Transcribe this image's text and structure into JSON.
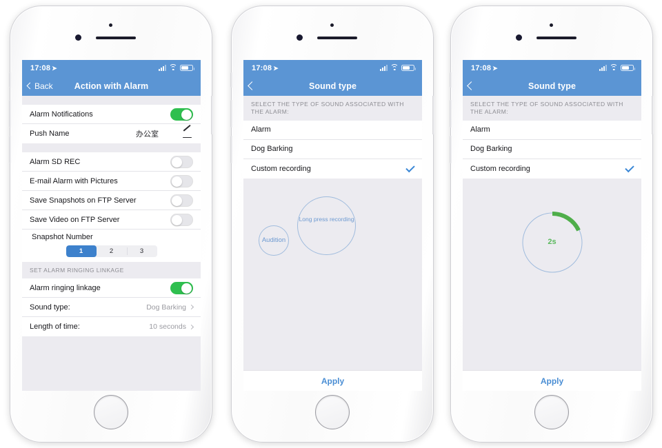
{
  "theme": {
    "header_blue": "#5b95d4",
    "accent_blue": "#3a87d6",
    "toggle_green": "#2fbf4f",
    "progress_green": "#4fae4a",
    "screen_gray": "#ecebf0"
  },
  "statusbar": {
    "time": "17:08",
    "location_arrow": "➤",
    "signal_icon": "cellular-bars-icon",
    "wifi_icon": "wifi-icon",
    "battery_icon": "battery-icon"
  },
  "phone1": {
    "nav": {
      "back_label": "Back",
      "title": "Action with Alarm"
    },
    "group1": [
      {
        "label": "Alarm Notifications",
        "control": "toggle",
        "on": true
      },
      {
        "label": "Push Name",
        "value": "办公室",
        "control": "pencil"
      }
    ],
    "group2": [
      {
        "label": "Alarm SD REC",
        "control": "toggle",
        "on": false
      },
      {
        "label": "E-mail Alarm with Pictures",
        "control": "toggle",
        "on": false
      },
      {
        "label": "Save Snapshots on FTP Server",
        "control": "toggle",
        "on": false
      },
      {
        "label": "Save Video on FTP Server",
        "control": "toggle",
        "on": false
      }
    ],
    "snapshot": {
      "label": "Snapshot Number",
      "options": [
        "1",
        "2",
        "3"
      ],
      "selected": "1"
    },
    "section_header": "SET ALARM RINGING LINKAGE",
    "group3": [
      {
        "label": "Alarm ringing linkage",
        "control": "toggle",
        "on": true
      },
      {
        "label": "Sound type:",
        "value": "Dog Barking",
        "control": "chevron"
      },
      {
        "label": "Length of time:",
        "value": "10 seconds",
        "control": "chevron"
      }
    ]
  },
  "phone2": {
    "nav": {
      "title": "Sound type",
      "back_icon": "chevron-left-icon"
    },
    "instruction": "SELECT THE TYPE OF SOUND ASSOCIATED WITH THE ALARM:",
    "options": [
      {
        "label": "Alarm",
        "selected": false
      },
      {
        "label": "Dog Barking",
        "selected": false
      },
      {
        "label": "Custom recording",
        "selected": true
      }
    ],
    "audition_button": "Audition",
    "record_button": "Long press recording",
    "apply_label": "Apply"
  },
  "phone3": {
    "nav": {
      "title": "Sound type",
      "back_icon": "chevron-left-icon"
    },
    "instruction": "SELECT THE TYPE OF SOUND ASSOCIATED WITH THE ALARM:",
    "options": [
      {
        "label": "Alarm",
        "selected": false
      },
      {
        "label": "Dog Barking",
        "selected": false
      },
      {
        "label": "Custom recording",
        "selected": true
      }
    ],
    "timer_value": "2s",
    "timer_progress_percent": 18,
    "apply_label": "Apply"
  }
}
